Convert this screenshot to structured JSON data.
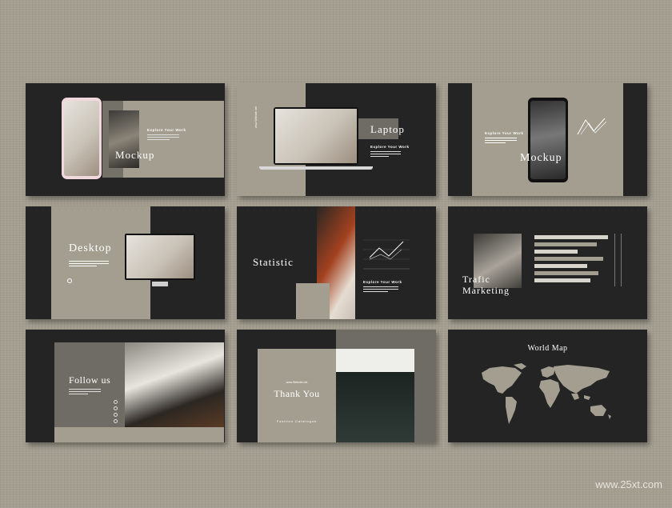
{
  "slides": {
    "s1": {
      "title": "Mockup",
      "label": "Explore Your Work"
    },
    "s2": {
      "title": "Laptop",
      "label": "Explore Your Work",
      "side": "www.Website.net"
    },
    "s3": {
      "title": "Mockup",
      "label": "Explore Your Work"
    },
    "s4": {
      "title": "Desktop"
    },
    "s5": {
      "title": "Statistic",
      "label": "Explore Your Work"
    },
    "s6": {
      "title_line1": "Trafic",
      "title_line2": "Marketing"
    },
    "s7": {
      "title": "Follow us"
    },
    "s8": {
      "title": "Thank You",
      "small": "www.Website.net",
      "subtitle": "Fashion Catalogue"
    },
    "s9": {
      "title": "World Map"
    }
  },
  "watermark": "www.25xt.com",
  "colors": {
    "dark": "#242424",
    "taupe": "#a39e8f",
    "grey": "#6e6c64",
    "background": "#a39e90"
  }
}
